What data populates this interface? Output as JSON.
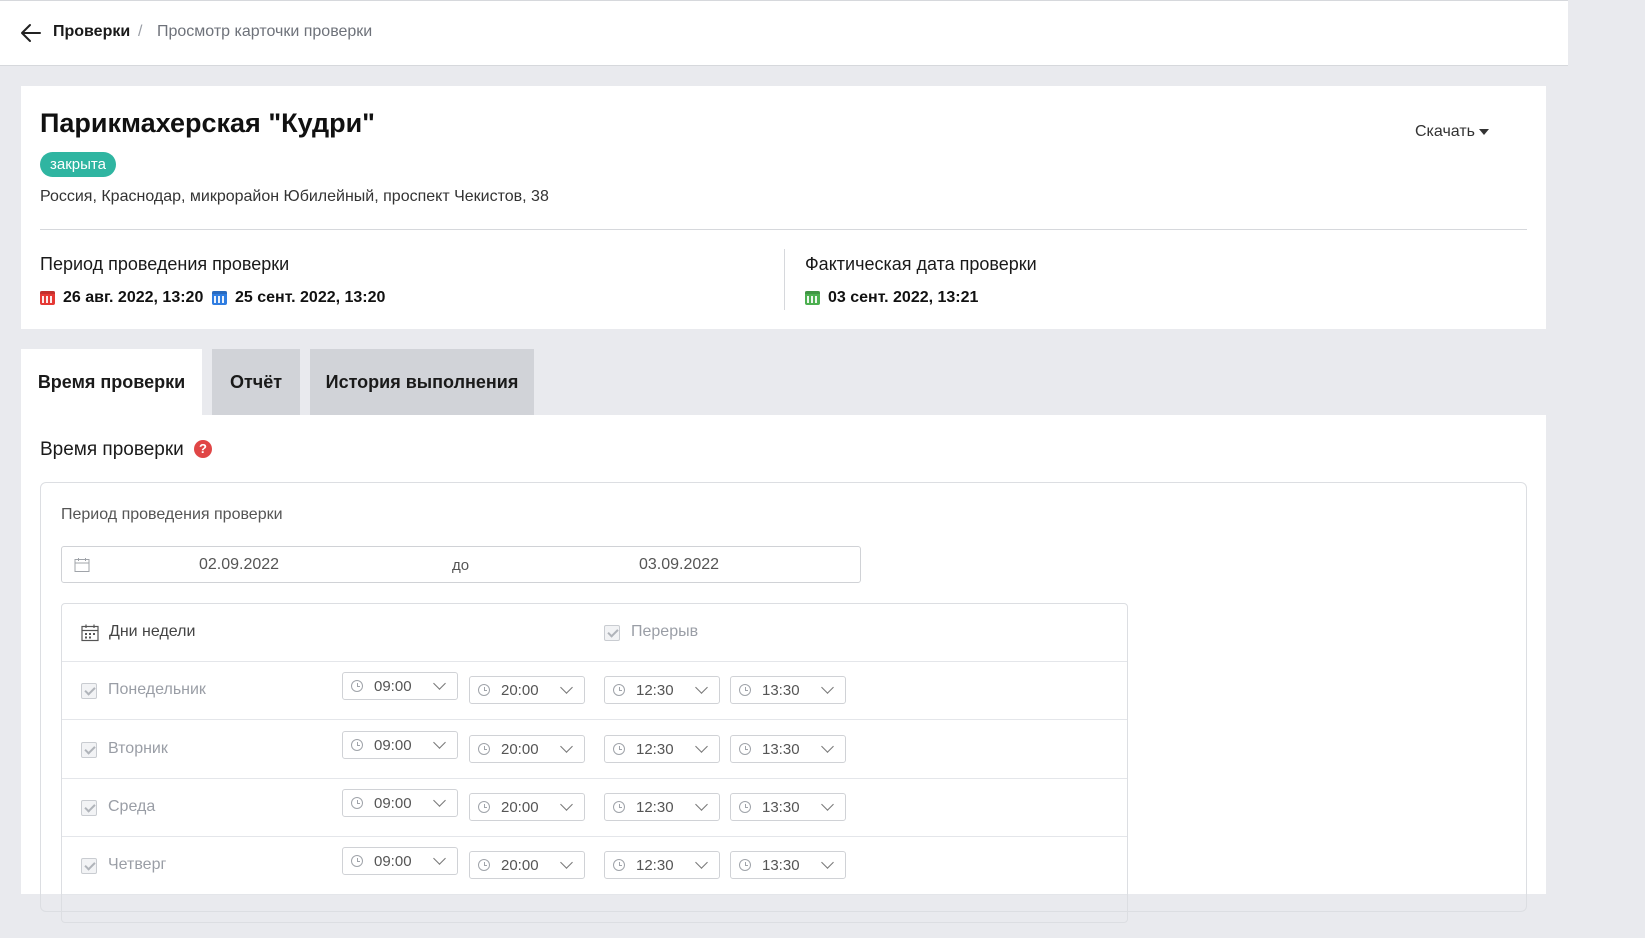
{
  "breadcrumb": {
    "root": "Проверки",
    "separator": "/",
    "current": "Просмотр карточки проверки"
  },
  "header": {
    "title": "Парикмахерская \"Кудри\"",
    "status": "закрыта",
    "address": "Россия, Краснодар, микрорайон Юбилейный, проспект Чекистов, 38",
    "download_label": "Скачать",
    "period_label": "Период проведения проверки",
    "period_start": "26 авг. 2022, 13:20",
    "period_end": "25 сент. 2022, 13:20",
    "fact_label": "Фактическая дата проверки",
    "fact_date": "03 сент. 2022, 13:21"
  },
  "colors": {
    "status": "#2fb5a1",
    "start_cal": "#e53935",
    "end_cal": "#2f7de1",
    "fact_cal": "#4caf50",
    "help": "#e04646"
  },
  "tabs": [
    {
      "label": "Время проверки",
      "active": true
    },
    {
      "label": "Отчёт",
      "active": false
    },
    {
      "label": "История выполнения",
      "active": false
    }
  ],
  "section": {
    "title": "Время проверки",
    "help_icon": "?"
  },
  "period": {
    "label": "Период проведения проверки",
    "from": "02.09.2022",
    "separator": "до",
    "to": "03.09.2022"
  },
  "schedule": {
    "days_header": "Дни недели",
    "break_header": "Перерыв",
    "rows": [
      {
        "day": "Понедельник",
        "start": "09:00",
        "end": "20:00",
        "break_start": "12:30",
        "break_end": "13:30"
      },
      {
        "day": "Вторник",
        "start": "09:00",
        "end": "20:00",
        "break_start": "12:30",
        "break_end": "13:30"
      },
      {
        "day": "Среда",
        "start": "09:00",
        "end": "20:00",
        "break_start": "12:30",
        "break_end": "13:30"
      },
      {
        "day": "Четверг",
        "start": "09:00",
        "end": "20:00",
        "break_start": "12:30",
        "break_end": "13:30"
      }
    ]
  }
}
